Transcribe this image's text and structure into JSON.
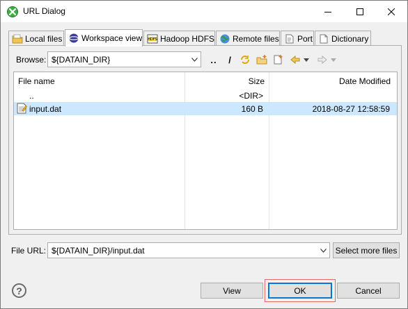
{
  "window": {
    "title": "URL Dialog",
    "colors": {
      "accent": "#0078d7",
      "selection": "#cce8ff",
      "highlight_outline": "#e26a6a"
    }
  },
  "tabs": [
    {
      "label": "Local files",
      "icon": "folder-icon",
      "active": false
    },
    {
      "label": "Workspace view",
      "icon": "workspace-icon",
      "active": true
    },
    {
      "label": "Hadoop HDFS",
      "icon": "hdfs-icon",
      "active": false
    },
    {
      "label": "Remote files",
      "icon": "globe-icon",
      "active": false
    },
    {
      "label": "Port",
      "icon": "port-icon",
      "active": false
    },
    {
      "label": "Dictionary",
      "icon": "dictionary-icon",
      "active": false
    }
  ],
  "browse": {
    "label": "Browse:",
    "value": "${DATAIN_DIR}",
    "toolbar": {
      "up_label": "..",
      "root_label": "/"
    }
  },
  "table": {
    "headers": {
      "name": "File name",
      "size": "Size",
      "modified": "Date Modified"
    },
    "rows": [
      {
        "name": "..",
        "size": "<DIR>",
        "modified": "",
        "selected": false,
        "icon": ""
      },
      {
        "name": "input.dat",
        "size": "160 B",
        "modified": "2018-08-27 12:58:59",
        "selected": true,
        "icon": "text-file-icon"
      }
    ]
  },
  "file_url": {
    "label": "File URL:",
    "value": "${DATAIN_DIR}/input.dat",
    "select_more_label": "Select more files"
  },
  "buttons": {
    "view": "View",
    "ok": "OK",
    "cancel": "Cancel",
    "help": "?"
  }
}
